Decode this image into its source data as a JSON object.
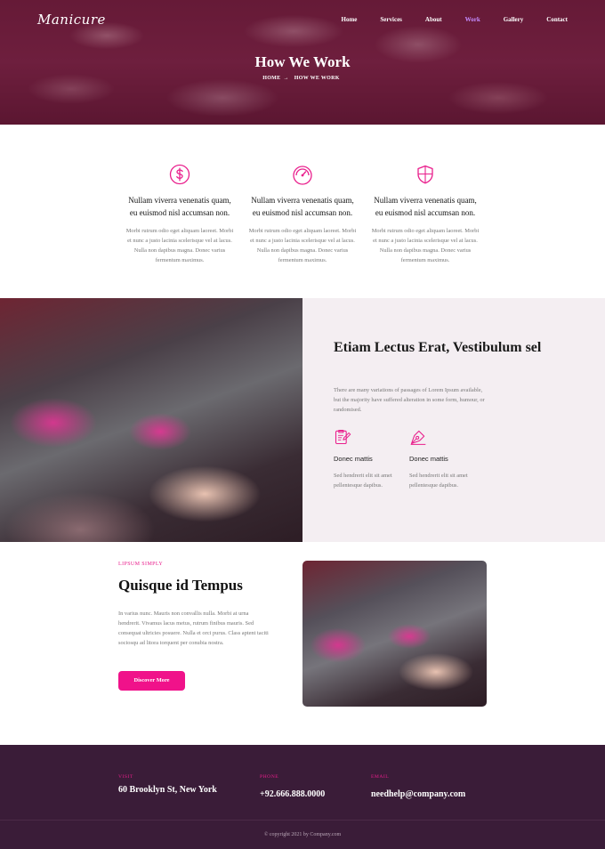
{
  "brand": {
    "logo": "Manicure",
    "accent": "#e91e8c",
    "nav_active_color": "#c58bff"
  },
  "nav": [
    {
      "label": "Home"
    },
    {
      "label": "Services"
    },
    {
      "label": "About"
    },
    {
      "label": "Work",
      "active": true
    },
    {
      "label": "Gallery"
    },
    {
      "label": "Contact"
    }
  ],
  "hero": {
    "title": "How We Work",
    "crumb_home": "HOME",
    "crumb_sep": "→",
    "crumb_current": "HOW WE WORK"
  },
  "features": [
    {
      "icon": "dollar-circle-icon",
      "title": "Nullam viverra venenatis quam, eu euismod nisl accumsan non.",
      "text": "Morbi rutrum odio eget aliquam laoreet. Morbi et nunc a justo lacinia scelerisque vel at lacus. Nulla non dapibus magna. Donec varius fermentum maximus."
    },
    {
      "icon": "speedometer-icon",
      "title": "Nullam viverra venenatis quam, eu euismod nisl accumsan non.",
      "text": "Morbi rutrum odio eget aliquam laoreet. Morbi et nunc a justo lacinia scelerisque vel at lacus. Nulla non dapibus magna. Donec varius fermentum maximus."
    },
    {
      "icon": "shield-icon",
      "title": "Nullam viverra venenatis quam, eu euismod nisl accumsan non.",
      "text": "Morbi rutrum odio eget aliquam laoreet. Morbi et nunc a justo lacinia scelerisque vel at lacus. Nulla non dapibus magna. Donec varius fermentum maximus."
    }
  ],
  "split": {
    "title": "Etiam Lectus Erat, Vestibulum sel",
    "text": "There are many variations of passages of Lorem Ipsum available, but the majority have suffered alteration in some form, humour, or randomised.",
    "items": [
      {
        "icon": "clipboard-edit-icon",
        "title": "Donec mattis",
        "text": "Sed hendrerit elit sit amet pellentesque dapibus."
      },
      {
        "icon": "pen-nib-icon",
        "title": "Donec mattis",
        "text": "Sed hendrerit elit sit amet pellentesque dapibus."
      }
    ]
  },
  "quisque": {
    "kicker": "LIPSUM SIMPLY",
    "title": "Quisque id Tempus",
    "text": "In varius nunc. Mauris non convallis nulla. Morbi at urna hendrerit. Vivamus lacus metus, rutrum finibus mauris. Sed consequat ultricies posuere. Nulla et orci purus. Class aptent taciti sociosqu ad litora torquent per conubia nostra.",
    "button": "Discover More"
  },
  "footer": {
    "visit_label": "VISIT",
    "visit": "60 Brooklyn St, New York",
    "phone_label": "PHONE",
    "phone": "+92.666.888.0000",
    "email_label": "EMAIL",
    "email": "needhelp@company.com",
    "copyright": "© copyright 2021 by Company.com"
  }
}
